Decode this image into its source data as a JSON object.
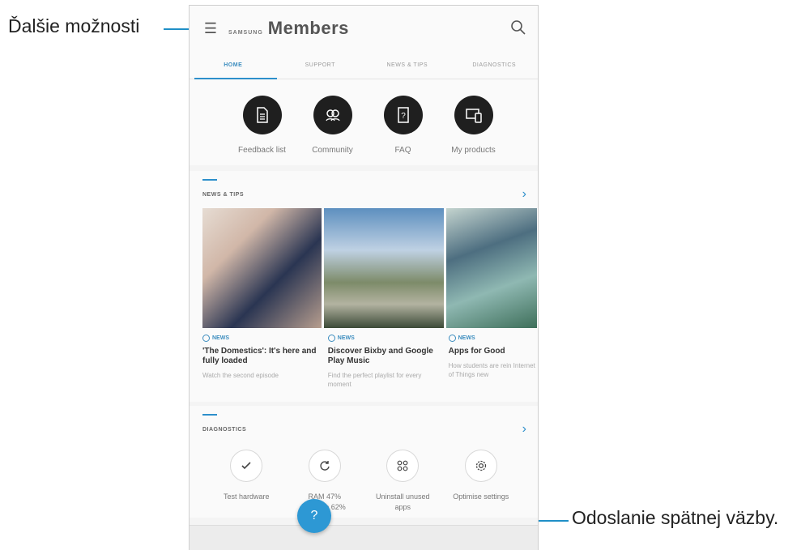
{
  "callouts": {
    "menu_label": "Ďalšie možnosti",
    "feedback_label": "Odoslanie spätnej väzby."
  },
  "appbar": {
    "brand_small": "SAMSUNG",
    "brand_big": "Members",
    "search_icon": "search-icon",
    "menu_icon": "hamburger-menu-icon"
  },
  "tabs": [
    {
      "label": "HOME",
      "active": true
    },
    {
      "label": "SUPPORT",
      "active": false
    },
    {
      "label": "NEWS & TIPS",
      "active": false
    },
    {
      "label": "DIAGNOSTICS",
      "active": false
    }
  ],
  "quick_actions": [
    {
      "label": "Feedback list",
      "icon": "document-icon"
    },
    {
      "label": "Community",
      "icon": "people-icon"
    },
    {
      "label": "FAQ",
      "icon": "question-book-icon"
    },
    {
      "label": "My products",
      "icon": "devices-icon"
    }
  ],
  "news": {
    "title": "NEWS & TIPS",
    "articles": [
      {
        "tag": "NEWS",
        "title": "'The Domestics': It's here and fully loaded",
        "desc": "Watch the second episode"
      },
      {
        "tag": "NEWS",
        "title": "Discover Bixby and Google Play Music",
        "desc": "Find the perfect playlist for every moment"
      },
      {
        "tag": "NEWS",
        "title": "Apps for Good",
        "desc": "How students are rein Internet of Things new"
      }
    ]
  },
  "diagnostics": {
    "title": "DIAGNOSTICS",
    "items": [
      {
        "label": "Test hardware",
        "icon": "check-icon"
      },
      {
        "label": "RAM 47%\nStorage 62%",
        "icon": "refresh-icon"
      },
      {
        "label": "Uninstall unused\napps",
        "icon": "apps-grid-icon"
      },
      {
        "label": "Optimise settings",
        "icon": "gear-icon"
      }
    ]
  },
  "fab": {
    "label": "?",
    "icon": "help-icon"
  },
  "colors": {
    "accent": "#2d8fcb",
    "fab": "#2d98d4",
    "dark_circle": "#1f1f1f"
  }
}
